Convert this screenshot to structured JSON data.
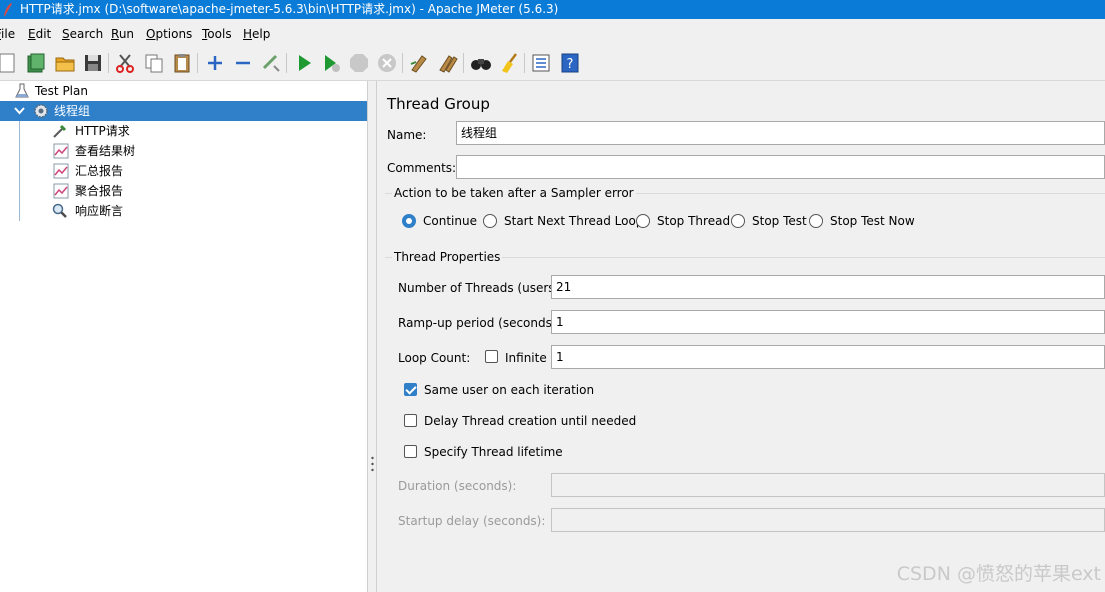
{
  "window": {
    "title": "HTTP请求.jmx (D:\\software\\apache-jmeter-5.6.3\\bin\\HTTP请求.jmx) - Apache JMeter (5.6.3)"
  },
  "menu": [
    "File",
    "Edit",
    "Search",
    "Run",
    "Options",
    "Tools",
    "Help"
  ],
  "toolbar": [
    "new-icon",
    "templates-icon",
    "open-icon",
    "save-icon",
    "cut-icon",
    "copy-icon",
    "paste-icon",
    "expand-icon",
    "collapse-icon",
    "toggle-icon",
    "start-icon",
    "start-no-pauses-icon",
    "stop-icon",
    "shutdown-icon",
    "clear-icon",
    "clear-all-icon",
    "search-icon",
    "reset-search-icon",
    "function-helper-icon",
    "help-icon"
  ],
  "tree": {
    "test_plan": "Test Plan",
    "thread_group": "线程组",
    "children": [
      "HTTP请求",
      "查看结果树",
      "汇总报告",
      "聚合报告",
      "响应断言"
    ]
  },
  "panel": {
    "title": "Thread Group",
    "name_label": "Name:",
    "name_value": "线程组",
    "comments_label": "Comments:",
    "comments_value": "",
    "sampler_error": {
      "title": "Action to be taken after a Sampler error",
      "options": [
        "Continue",
        "Start Next Thread Loop",
        "Stop Thread",
        "Stop Test",
        "Stop Test Now"
      ],
      "selected": "Continue"
    },
    "thread_props": {
      "title": "Thread Properties",
      "threads_label": "Number of Threads (users):",
      "threads_value": "21",
      "rampup_label": "Ramp-up period (seconds):",
      "rampup_value": "1",
      "loop_label": "Loop Count:",
      "infinite_label": "Infinite",
      "infinite_checked": false,
      "loop_value": "1",
      "same_user_label": "Same user on each iteration",
      "same_user_checked": true,
      "delay_label": "Delay Thread creation until needed",
      "delay_checked": false,
      "lifetime_label": "Specify Thread lifetime",
      "lifetime_checked": false,
      "duration_label": "Duration (seconds):",
      "duration_value": "",
      "startup_label": "Startup delay (seconds):",
      "startup_value": ""
    }
  },
  "watermark": "CSDN @愤怒的苹果ext"
}
